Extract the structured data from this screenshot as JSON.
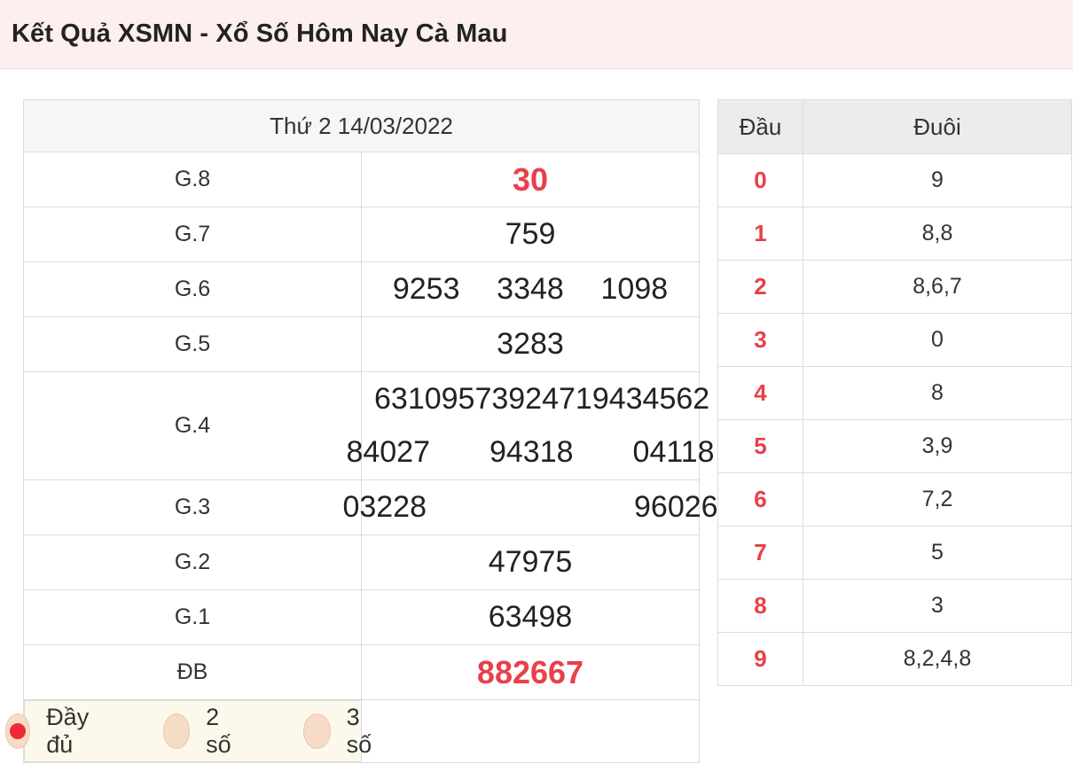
{
  "page": {
    "title": "Kết Quả XSMN - Xổ Số Hôm Nay Cà Mau"
  },
  "results": {
    "date": "Thứ 2 14/03/2022",
    "rows": {
      "g8": {
        "label": "G.8",
        "numbers": [
          "30"
        ]
      },
      "g7": {
        "label": "G.7",
        "numbers": [
          "759"
        ]
      },
      "g6": {
        "label": "G.6",
        "numbers": [
          "9253",
          "3348",
          "1098"
        ]
      },
      "g5": {
        "label": "G.5",
        "numbers": [
          "3283"
        ]
      },
      "g4": {
        "label": "G.4",
        "numbers": [
          "63109",
          "57392",
          "47194",
          "34562",
          "84027",
          "94318",
          "04118"
        ]
      },
      "g3": {
        "label": "G.3",
        "numbers": [
          "03228",
          "96026"
        ]
      },
      "g2": {
        "label": "G.2",
        "numbers": [
          "47975"
        ]
      },
      "g1": {
        "label": "G.1",
        "numbers": [
          "63498"
        ]
      },
      "db": {
        "label": "ĐB",
        "numbers": [
          "882667"
        ]
      }
    },
    "modes": [
      {
        "label": "Đầy đủ",
        "selected": true
      },
      {
        "label": "2 số",
        "selected": false
      },
      {
        "label": "3 số",
        "selected": false
      }
    ]
  },
  "loto": {
    "headers": {
      "dau": "Đầu",
      "duoi": "Đuôi"
    },
    "rows": [
      {
        "dau": "0",
        "duoi": "9"
      },
      {
        "dau": "1",
        "duoi": "8,8"
      },
      {
        "dau": "2",
        "duoi": "8,6,7"
      },
      {
        "dau": "3",
        "duoi": "0"
      },
      {
        "dau": "4",
        "duoi": "8"
      },
      {
        "dau": "5",
        "duoi": "3,9"
      },
      {
        "dau": "6",
        "duoi": "7,2"
      },
      {
        "dau": "7",
        "duoi": "5"
      },
      {
        "dau": "8",
        "duoi": "3"
      },
      {
        "dau": "9",
        "duoi": "8,2,4,8"
      }
    ]
  },
  "colors": {
    "accent_red": "#e8404a",
    "title_bg": "#fdeeef",
    "modes_bg": "#fdf8ec"
  }
}
